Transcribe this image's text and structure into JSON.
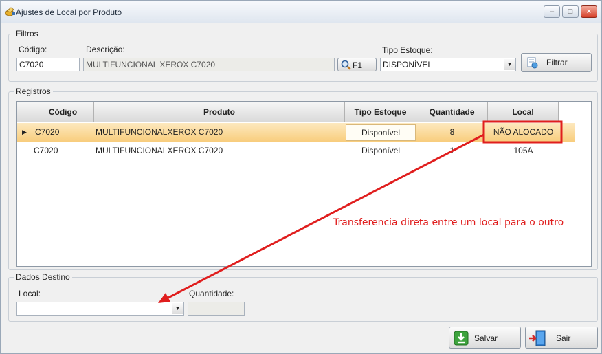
{
  "window": {
    "title": "Ajustes de Local por Produto",
    "min": "–",
    "max": "□",
    "close": "×"
  },
  "filtros": {
    "legend": "Filtros",
    "codigo_label": "Código:",
    "codigo_value": "C7020",
    "descricao_label": "Descrição:",
    "descricao_value": "MULTIFUNCIONAL XEROX C7020",
    "f1_label": "F1",
    "tipo_label": "Tipo Estoque:",
    "tipo_value": "DISPONÍVEL",
    "filtrar_label": "Filtrar"
  },
  "registros": {
    "legend": "Registros",
    "columns": [
      "Código",
      "Produto",
      "Tipo Estoque",
      "Quantidade",
      "Local"
    ],
    "rows": [
      {
        "codigo": "C7020",
        "produto": "MULTIFUNCIONALXEROX C7020",
        "tipo": "Disponível",
        "quantidade": "8",
        "local": "NÃO ALOCADO"
      },
      {
        "codigo": "C7020",
        "produto": "MULTIFUNCIONALXEROX C7020",
        "tipo": "Disponível",
        "quantidade": "1",
        "local": "105A"
      }
    ],
    "row_indicator": "▶"
  },
  "destino": {
    "legend": "Dados Destino",
    "local_label": "Local:",
    "local_value": "",
    "quantidade_label": "Quantidade:",
    "quantidade_value": ""
  },
  "footer": {
    "salvar_label": "Salvar",
    "sair_label": "Sair"
  },
  "annotation": {
    "text": "Transferencia direta entre um local para o outro",
    "color": "#e01e1e"
  }
}
